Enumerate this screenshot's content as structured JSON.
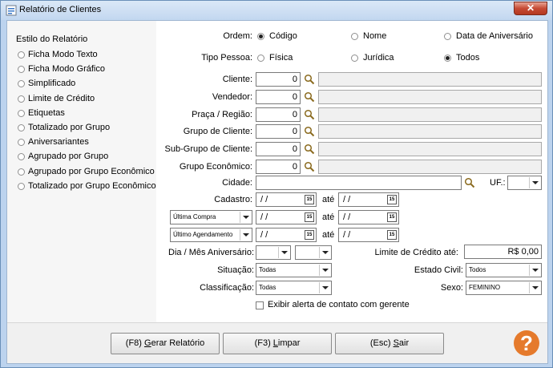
{
  "window": {
    "title": "Relatório de Clientes",
    "close_label": "✕"
  },
  "report_style": {
    "heading": "Estilo do Relatório",
    "options": [
      "Ficha Modo Texto",
      "Ficha Modo Gráfico",
      "Simplificado",
      "Limite de Crédito",
      "Etiquetas",
      "Totalizado por Grupo",
      "Aniversariantes",
      "Agrupado por Grupo",
      "Agrupado por Grupo Econômico",
      "Totalizado por Grupo Econômico"
    ]
  },
  "ordem": {
    "label": "Ordem:",
    "options": [
      "Código",
      "Nome",
      "Data de Aniversário"
    ],
    "selected": "Código"
  },
  "tipo_pessoa": {
    "label": "Tipo Pessoa:",
    "options": [
      "Física",
      "Jurídica",
      "Todos"
    ],
    "selected": "Todos"
  },
  "lookups": [
    {
      "label": "Cliente:",
      "value": "0"
    },
    {
      "label": "Vendedor:",
      "value": "0"
    },
    {
      "label": "Praça / Região:",
      "value": "0"
    },
    {
      "label": "Grupo de Cliente:",
      "value": "0"
    },
    {
      "label": "Sub-Grupo de Cliente:",
      "value": "0"
    },
    {
      "label": "Grupo Econômico:",
      "value": "0"
    }
  ],
  "cidade": {
    "label": "Cidade:",
    "value": ""
  },
  "uf": {
    "label": "UF.:",
    "value": ""
  },
  "date_rows": [
    {
      "label": "Cadastro:",
      "from": " /  /",
      "to": " /  /",
      "sep": "até"
    },
    {
      "selector": "Última Compra",
      "from": " /  /",
      "to": " /  /",
      "sep": "até"
    },
    {
      "selector": "Último Agendamento",
      "from": " /  /",
      "to": " /  /",
      "sep": "até"
    }
  ],
  "calendar_badge": "15",
  "dia_mes": {
    "label": "Dia / Mês Aniversário:"
  },
  "limite_credito": {
    "label": "Limite de Crédito até:",
    "value": "R$ 0,00"
  },
  "situacao": {
    "label": "Situação:",
    "value": "Todas"
  },
  "estado_civil": {
    "label": "Estado Civil:",
    "value": "Todos"
  },
  "classificacao": {
    "label": "Classificação:",
    "value": "Todas"
  },
  "sexo": {
    "label": "Sexo:",
    "value": "FEMININO"
  },
  "alerta": {
    "label": "Exibir alerta de contato com gerente",
    "checked": false
  },
  "buttons": {
    "gerar": {
      "prefix": "(F8) ",
      "accel": "G",
      "rest": "erar Relatório"
    },
    "limpar": {
      "prefix": "(F3) ",
      "accel": "L",
      "rest": "impar"
    },
    "sair": {
      "prefix": "(Esc) ",
      "accel": "S",
      "rest": "air"
    }
  },
  "help_label": "?"
}
